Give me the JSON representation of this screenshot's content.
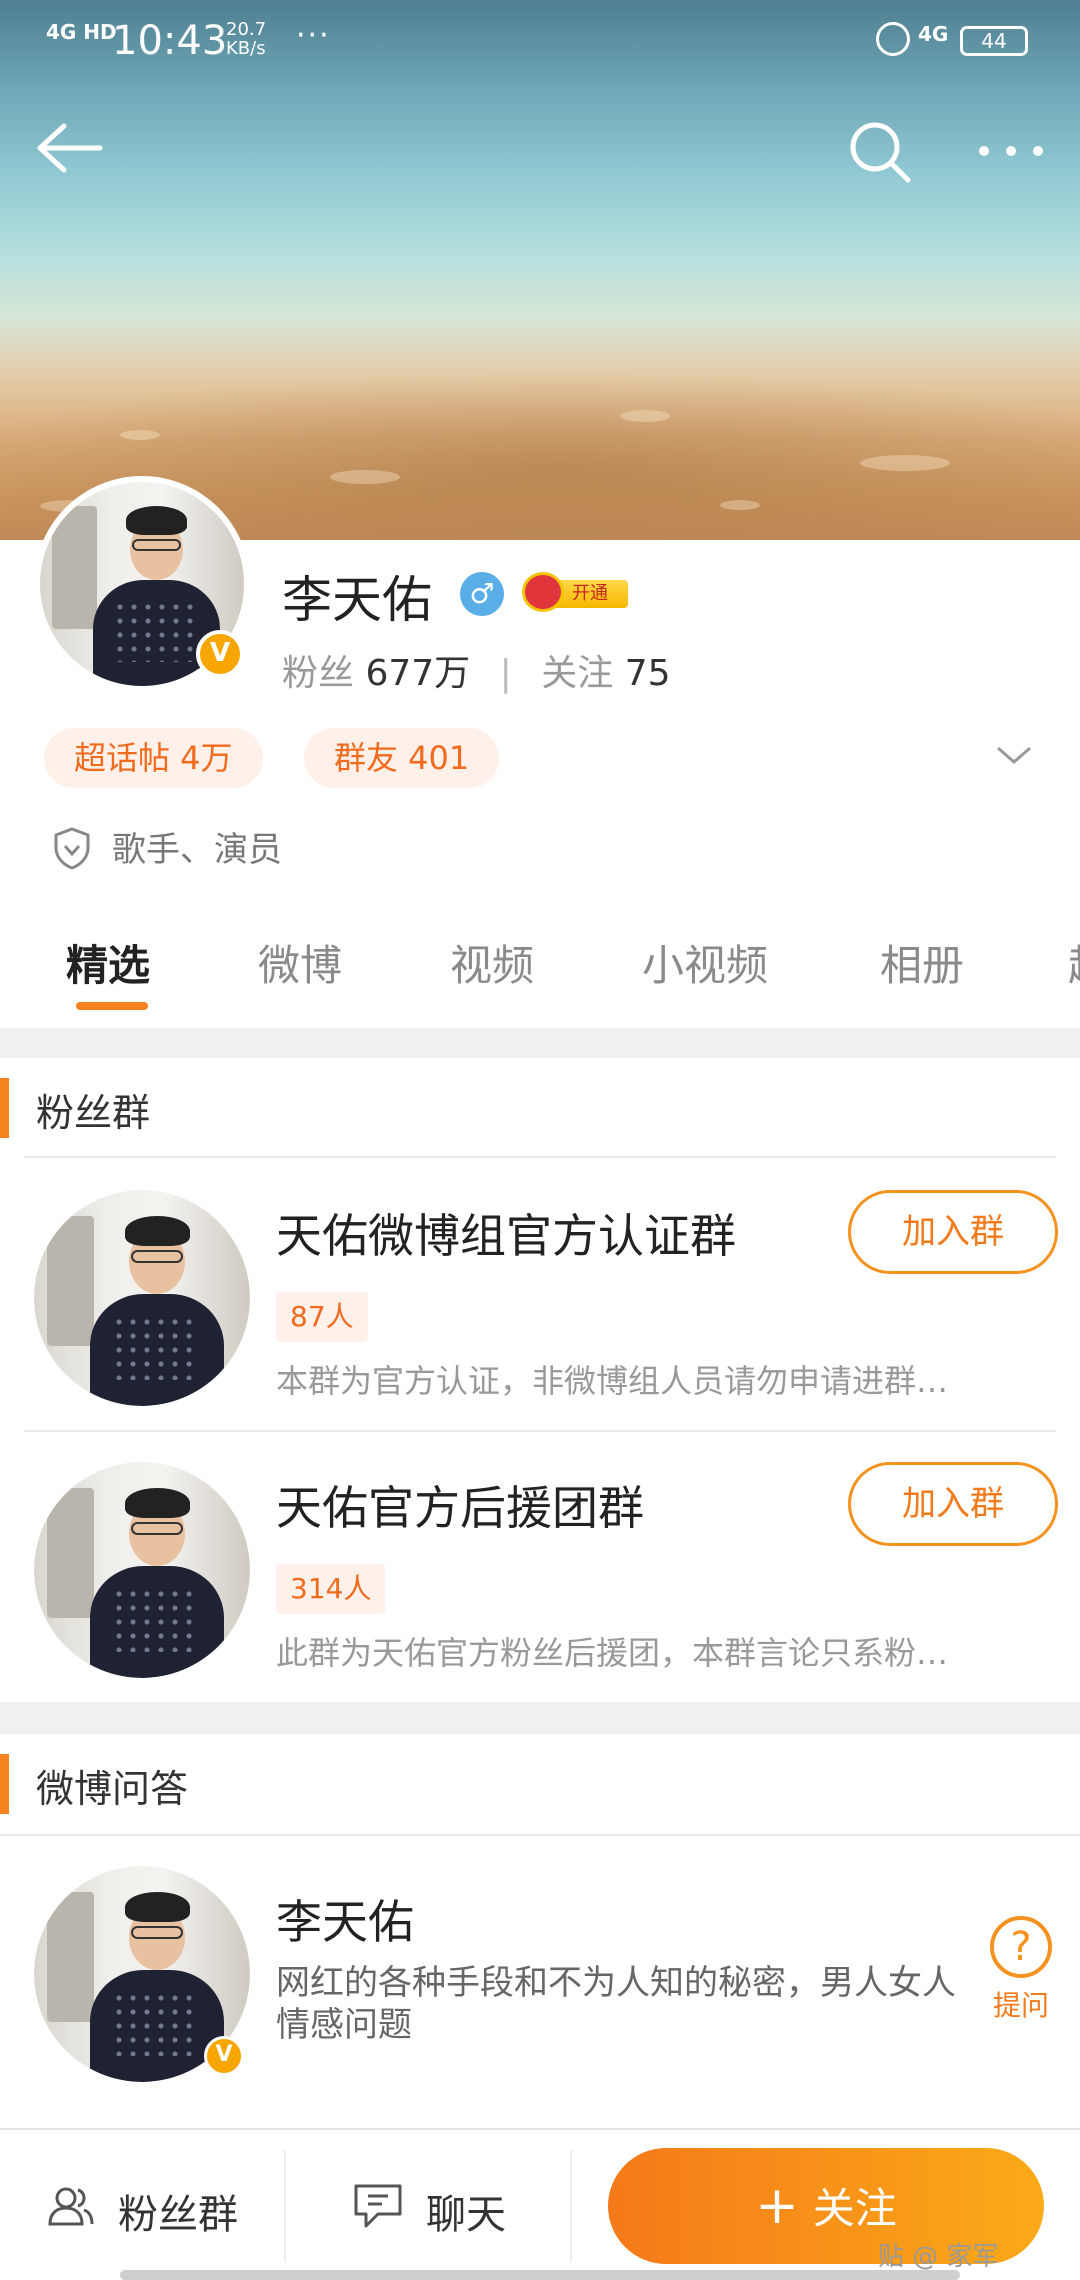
{
  "status_bar": {
    "network": "4G HD",
    "time": "10:43",
    "speed_value": "20.7",
    "speed_unit": "KB/s",
    "more": "···",
    "network_right": "4G",
    "battery": "44"
  },
  "profile": {
    "name": "李天佑",
    "followers_label": "粉丝",
    "followers": "677万",
    "following_label": "关注",
    "following": "75",
    "vip_tag": "开通",
    "verified_mark": "V",
    "gender_mark": "♂",
    "pills": [
      {
        "label": "超话帖 4万"
      },
      {
        "label": "群友 401"
      }
    ],
    "identity": "歌手、演员"
  },
  "tabs": [
    {
      "label": "精选"
    },
    {
      "label": "微博"
    },
    {
      "label": "视频"
    },
    {
      "label": "小视频"
    },
    {
      "label": "相册"
    },
    {
      "label": "超"
    }
  ],
  "fan_groups": {
    "title": "粉丝群",
    "groups": [
      {
        "name": "天佑微博组官方认证群",
        "count": "87人",
        "desc": "本群为官方认证，非微博组人员请勿申请进群…",
        "button": "加入群"
      },
      {
        "name": "天佑官方后援团群",
        "count": "314人",
        "desc": "此群为天佑官方粉丝后援团，本群言论只系粉…",
        "button": "加入群"
      }
    ]
  },
  "qa": {
    "title": "微博问答",
    "name": "李天佑",
    "desc": "网红的各种手段和不为人知的秘密，男人女人情感问题",
    "ask_label": "提问",
    "ask_mark": "?"
  },
  "bottom_bar": {
    "fans_group": "粉丝群",
    "chat": "聊天",
    "follow_plus": "+",
    "follow": "关注"
  },
  "watermark": "贴 @ 家军",
  "colors": {
    "accent": "#f5821f",
    "pill_bg": "#fff0ea",
    "pill_text": "#f26b1d",
    "verified": "#f7a600",
    "gender": "#5aaee8"
  },
  "icons": [
    "back-arrow-icon",
    "search-icon",
    "more-icon",
    "alarm-icon",
    "shield-icon",
    "chevron-down-icon",
    "people-icon",
    "chat-icon",
    "question-icon"
  ]
}
